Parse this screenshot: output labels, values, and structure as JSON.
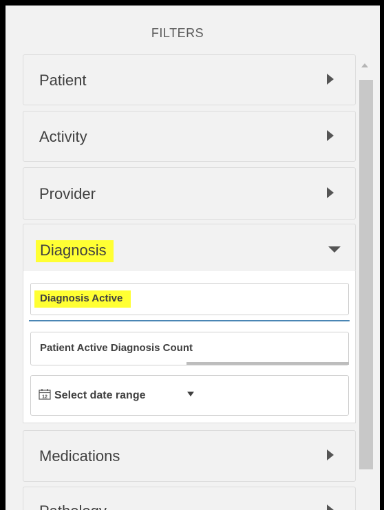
{
  "header": {
    "title": "FILTERS"
  },
  "panels": {
    "patient": "Patient",
    "activity": "Activity",
    "provider": "Provider",
    "diagnosis": "Diagnosis",
    "medications": "Medications",
    "next": "Pathology"
  },
  "diagnosis_fields": {
    "active": "Diagnosis Active",
    "count": "Patient Active Diagnosis Count",
    "date_range": "Select date range"
  },
  "colors": {
    "highlight": "#ffff33",
    "accent_line": "#4a86b4",
    "panel_bg": "#f2f2f2"
  },
  "icons": {
    "calendar": "calendar-icon",
    "expand": "chevron-right-icon",
    "collapse": "chevron-down-icon",
    "dropdown": "caret-down-icon"
  }
}
